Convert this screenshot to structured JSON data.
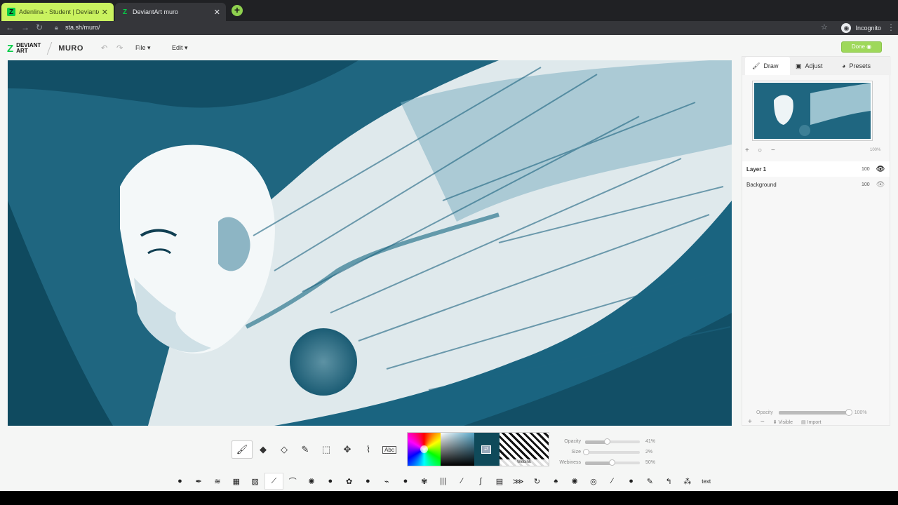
{
  "browser": {
    "tabs": [
      {
        "title": "Adenlina - Student | DeviantArt",
        "favicon": "deviantart-icon",
        "active": false
      },
      {
        "title": "DeviantArt muro",
        "favicon": "deviantart-icon",
        "active": true
      }
    ],
    "url": "sta.sh/muro/",
    "profile_label": "Incognito"
  },
  "app": {
    "logo_line1": "DEVIANT",
    "logo_line2": "ART",
    "app_name": "MURO",
    "menu": {
      "file": "File",
      "edit": "Edit"
    },
    "done_label": "Done",
    "accent_color": "#05cc47",
    "done_color": "#9ed85a"
  },
  "right_panel": {
    "tabs": [
      {
        "label": "Draw",
        "icon": "brush-icon"
      },
      {
        "label": "Adjust",
        "icon": "image-icon"
      },
      {
        "label": "Presets",
        "icon": "palette-icon"
      }
    ],
    "zoom_label": "100%",
    "layers": [
      {
        "name": "Layer 1",
        "opacity": "100",
        "selected": true
      },
      {
        "name": "Background",
        "opacity": "100",
        "selected": false
      }
    ],
    "layer_opacity_label": "Opacity",
    "layer_opacity_value": "100%",
    "layer_opacity_fraction": 1.0,
    "visible_label": "Visible",
    "import_label": "Import"
  },
  "tools": [
    "brush-tool",
    "eraser-tool",
    "fill-tool",
    "eyedropper-tool",
    "select-tool",
    "move-tool",
    "smudge-tool",
    "text-tool"
  ],
  "text_tool_label": "Abc",
  "color_panel": {
    "texture_label": "Webink",
    "current_color": "#0f4a5a"
  },
  "brush_settings": [
    {
      "label": "Opacity",
      "value": "41%",
      "fraction": 0.41
    },
    {
      "label": "Size",
      "value": "2%",
      "fraction": 0.02
    },
    {
      "label": "Webiness",
      "value": "50%",
      "fraction": 0.5
    }
  ],
  "brush_count": 30,
  "text_brush_label": "text"
}
